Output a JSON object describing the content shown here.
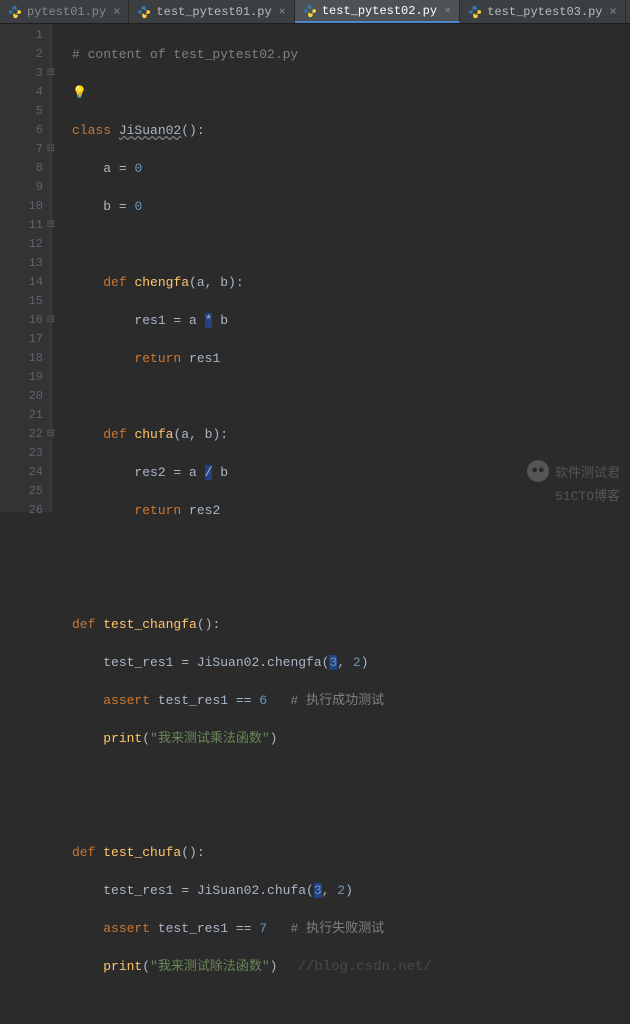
{
  "tabs": [
    {
      "label": "pytest01.py",
      "active": false,
      "dim": true
    },
    {
      "label": "test_pytest01.py",
      "active": false,
      "dim": false
    },
    {
      "label": "test_pytest02.py",
      "active": true,
      "dim": false
    },
    {
      "label": "test_pytest03.py",
      "active": false,
      "dim": false
    }
  ],
  "lines": {
    "l1_cmt": "# content of test_pytest02.py",
    "l3_class_kw": "class",
    "l3_class_name": "JiSuan02",
    "l3_paren": "():",
    "l4_a": "a = ",
    "l4_zero": "0",
    "l5_b": "b = ",
    "l5_zero": "0",
    "l7_def": "def",
    "l7_fn": "chengfa",
    "l7_sig": "(a, b):",
    "l8_assign": "res1 = a ",
    "l8_op": "*",
    "l8_b": " b",
    "l9_ret": "return",
    "l9_var": " res1",
    "l11_def": "def",
    "l11_fn": "chufa",
    "l11_sig": "(a, b):",
    "l12_assign": "res2 = a ",
    "l12_op": "/",
    "l12_b": " b",
    "l13_ret": "return",
    "l13_var": " res2",
    "l16_def": "def",
    "l16_fn": "test_changfa",
    "l16_sig": "():",
    "l17_assign": "test_res1 = JiSuan02.chengfa(",
    "l17_3": "3",
    "l17_comma": ", ",
    "l17_2": "2",
    "l17_close": ")",
    "l18_assert": "assert",
    "l18_expr": " test_res1 == ",
    "l18_6": "6",
    "l18_cmt": "   # 执行成功测试",
    "l19_print": "print",
    "l19_open": "(",
    "l19_str": "\"我来测试乘法函数\"",
    "l19_close": ")",
    "l22_def": "def",
    "l22_fn": "test_chufa",
    "l22_sig": "():",
    "l23_assign": "test_res1 = JiSuan02.chufa(",
    "l23_3": "3",
    "l23_comma": ", ",
    "l23_2": "2",
    "l23_close": ")",
    "l24_assert": "assert",
    "l24_expr": " test_res1 == ",
    "l24_7": "7",
    "l24_cmt": "   # 执行失败测试",
    "l25_print": "print",
    "l25_open": "(",
    "l25_str": "\"我来测试除法函数\"",
    "l25_close": ")"
  },
  "line_numbers": [
    "1",
    "2",
    "3",
    "4",
    "5",
    "6",
    "7",
    "8",
    "9",
    "10",
    "11",
    "12",
    "13",
    "14",
    "15",
    "16",
    "17",
    "18",
    "19",
    "20",
    "21",
    "22",
    "23",
    "24",
    "25",
    "26"
  ],
  "watermark": {
    "blog": "//blog.csdn.net/",
    "brand": "软件测试君",
    "cto": "51CTO博客"
  }
}
